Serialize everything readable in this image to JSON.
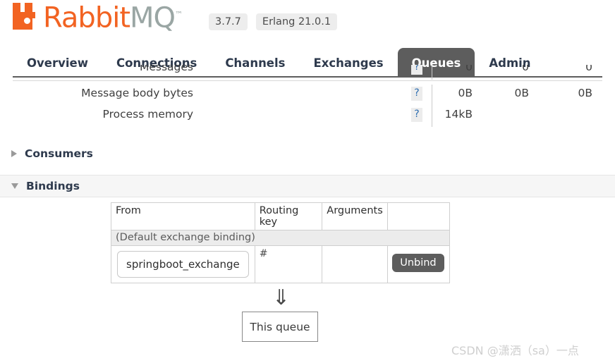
{
  "header": {
    "brand_rabbit": "Rabbit",
    "brand_mq": "MQ",
    "trademark": "™",
    "logo_icon": "rabbitmq-logo-icon",
    "version_badge": "3.7.7",
    "erlang_badge": "Erlang 21.0.1"
  },
  "nav": {
    "items": [
      {
        "label": "Overview",
        "active": false
      },
      {
        "label": "Connections",
        "active": false
      },
      {
        "label": "Channels",
        "active": false
      },
      {
        "label": "Exchanges",
        "active": false
      },
      {
        "label": "Queues",
        "active": true
      },
      {
        "label": "Admin",
        "active": false
      }
    ]
  },
  "stats": {
    "help_marker": "?",
    "rows": [
      {
        "label": "Messages",
        "v1": "0",
        "v2": "0",
        "v3": "0"
      },
      {
        "label": "Message body bytes",
        "v1": "0B",
        "v2": "0B",
        "v3": "0B"
      },
      {
        "label": "Process memory",
        "v1": "14kB",
        "v2": "",
        "v3": ""
      }
    ]
  },
  "sections": {
    "consumers": {
      "title": "Consumers",
      "expanded": false
    },
    "bindings": {
      "title": "Bindings",
      "expanded": true
    }
  },
  "bindings": {
    "columns": [
      "From",
      "Routing key",
      "Arguments",
      ""
    ],
    "default_binding_label": "(Default exchange binding)",
    "rows": [
      {
        "from": "springboot_exchange",
        "routing_key": "#",
        "arguments": "",
        "action_label": "Unbind"
      }
    ]
  },
  "diagram": {
    "arrow_glyph": "⇓",
    "queue_label": "This queue"
  },
  "watermark": {
    "text": "CSDN @潇洒（sa）一点"
  },
  "colors": {
    "brand_orange": "#F26322",
    "brand_gray": "#9aa6a4",
    "active_tab": "#5d5d5d",
    "help_blue": "#2b6cb0"
  }
}
